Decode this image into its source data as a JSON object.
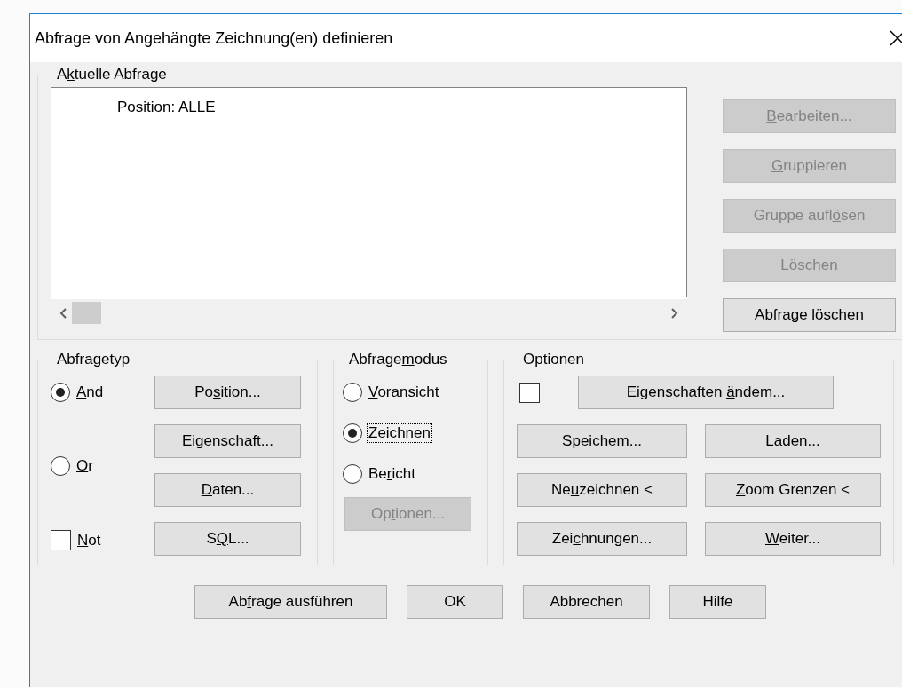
{
  "window": {
    "title": "Abfrage von Angehängte Zeichnung(en) definieren"
  },
  "current_query": {
    "label": {
      "pre": "A",
      "key": "k",
      "post": "tuelle Abfrage"
    },
    "lines": [
      "Position: ALLE"
    ],
    "buttons": [
      {
        "label": {
          "key": "B",
          "post": "earbeiten..."
        },
        "disabled": true
      },
      {
        "label": {
          "key": "G",
          "post": "ruppieren"
        },
        "disabled": true
      },
      {
        "label": {
          "pre": "Gruppe aufl",
          "key": "ö",
          "post": "sen"
        },
        "disabled": true
      },
      {
        "label": {
          "pre": "Löschen"
        },
        "disabled": true
      },
      {
        "label": {
          "pre": "Abfrage löschen"
        },
        "disabled": false
      }
    ]
  },
  "query_type": {
    "label": {
      "pre": "Abfragetyp"
    },
    "radios": [
      {
        "label": {
          "key": "A",
          "post": "nd"
        },
        "selected": true
      },
      {
        "label": {
          "key": "O",
          "post": "r"
        },
        "selected": false
      }
    ],
    "not": {
      "label": {
        "key": "N",
        "post": "ot"
      },
      "checked": false
    },
    "buttons": [
      {
        "label": {
          "pre": "Po",
          "key": "s",
          "post": "ition..."
        },
        "disabled": false
      },
      {
        "label": {
          "key": "E",
          "post": "igenschaft..."
        },
        "disabled": false
      },
      {
        "label": {
          "key": "D",
          "post": "aten..."
        },
        "disabled": false
      },
      {
        "label": {
          "pre": "S",
          "key": "Q",
          "post": "L..."
        },
        "disabled": false
      }
    ]
  },
  "query_mode": {
    "label": {
      "pre": "Abfrage",
      "key": "m",
      "post": "odus"
    },
    "radios": [
      {
        "label": {
          "key": "V",
          "post": "oransicht"
        },
        "selected": false,
        "focused": false
      },
      {
        "label": {
          "pre": "Zeic",
          "key": "h",
          "post": "nen"
        },
        "selected": true,
        "focused": true
      },
      {
        "label": {
          "pre": "Be",
          "key": "r",
          "post": "icht"
        },
        "selected": false,
        "focused": false
      }
    ],
    "button": {
      "label": {
        "pre": "Op",
        "key": "t",
        "post": "ionen..."
      },
      "disabled": true
    }
  },
  "options": {
    "label": {
      "pre": "Optionen"
    },
    "checkbox": {
      "checked": false
    },
    "main_button": {
      "label": {
        "pre": "Eigenschaften ",
        "key": "ä",
        "post": "ndem..."
      },
      "disabled": false
    },
    "buttons": [
      {
        "label": {
          "pre": "Speiche",
          "key": "m",
          "post": "..."
        },
        "disabled": false
      },
      {
        "label": {
          "key": "L",
          "post": "aden..."
        },
        "disabled": false
      },
      {
        "label": {
          "pre": "Ne",
          "key": "u",
          "post": "zeichnen <"
        },
        "disabled": false
      },
      {
        "label": {
          "key": "Z",
          "post": "oom Grenzen <"
        },
        "disabled": false
      },
      {
        "label": {
          "pre": "Zei",
          "key": "c",
          "post": "hnungen..."
        },
        "disabled": false
      },
      {
        "label": {
          "key": "W",
          "post": "eiter..."
        },
        "disabled": false
      }
    ]
  },
  "footer_buttons": [
    {
      "label": {
        "pre": "Ab",
        "key": "f",
        "post": "rage ausführen"
      },
      "disabled": false
    },
    {
      "label": {
        "pre": "OK"
      },
      "disabled": false
    },
    {
      "label": {
        "pre": "Abbrechen"
      },
      "disabled": false
    },
    {
      "label": {
        "pre": "Hilfe"
      },
      "disabled": false
    }
  ]
}
